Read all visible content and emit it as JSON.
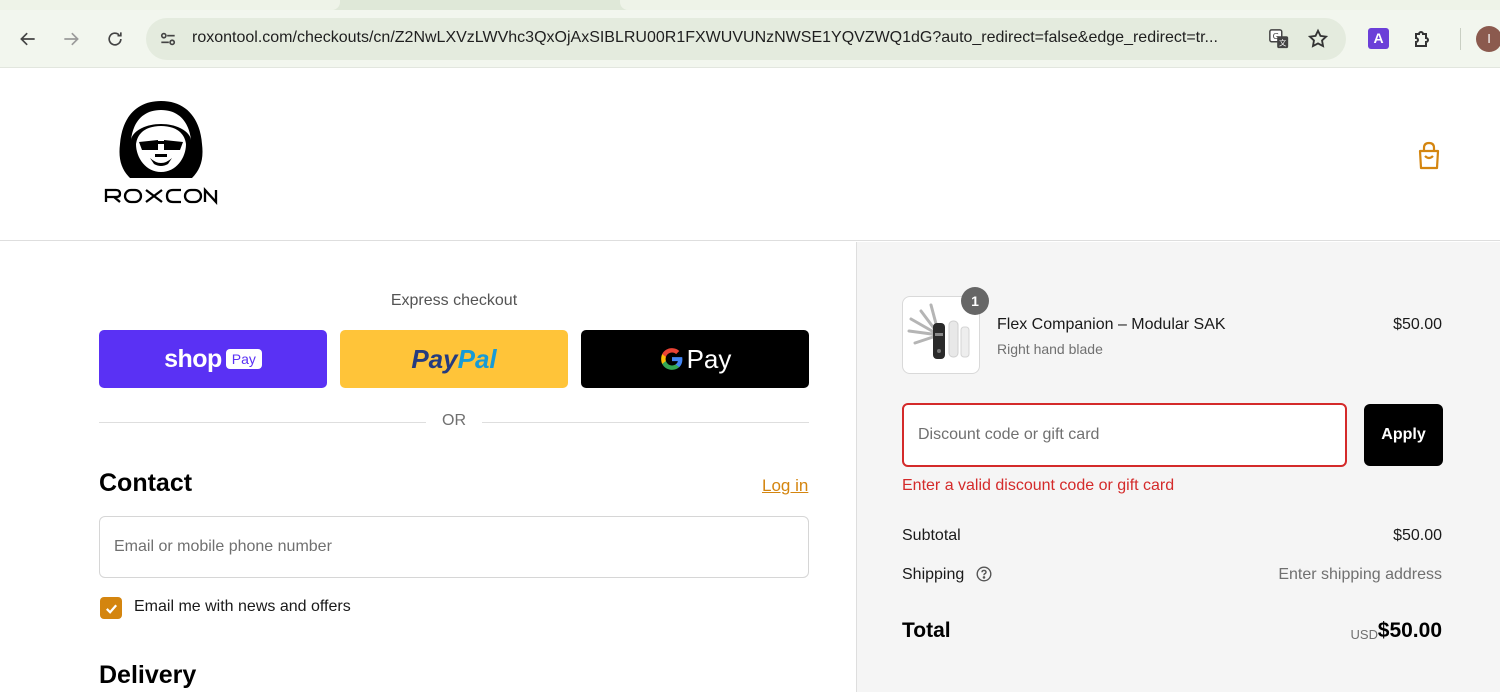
{
  "browser": {
    "url": "roxontool.com/checkouts/cn/Z2NwLXVzLWVhc3QxOjAxSIBLRU00R1FXWUVUNzNWSE1YQVZWQ1dG?auto_redirect=false&edge_redirect=tr...",
    "extension_label": "A",
    "profile_initial": "I"
  },
  "header": {
    "logo_text": "ROXCON"
  },
  "express": {
    "label": "Express checkout",
    "shop_text": "shop",
    "shop_pay_badge": "Pay",
    "paypal_pay": "Pay",
    "paypal_pal": "Pal",
    "gpay_text": "Pay",
    "or_label": "OR"
  },
  "contact": {
    "title": "Contact",
    "login_label": "Log in",
    "email_placeholder": "Email or mobile phone number",
    "newsletter_label": "Email me with news and offers",
    "newsletter_checked": true
  },
  "delivery": {
    "title": "Delivery"
  },
  "summary": {
    "product": {
      "name": "Flex Companion – Modular SAK",
      "variant": "Right hand blade",
      "price": "$50.00",
      "quantity": "1"
    },
    "discount_placeholder": "Discount code or gift card",
    "apply_label": "Apply",
    "discount_error": "Enter a valid discount code or gift card",
    "subtotal_label": "Subtotal",
    "subtotal_value": "$50.00",
    "shipping_label": "Shipping",
    "shipping_value": "Enter shipping address",
    "total_label": "Total",
    "currency": "USD",
    "total_value": "$50.00"
  },
  "colors": {
    "accent": "#d4850f",
    "error": "#d42a2a",
    "shop_pay": "#5a31f4",
    "paypal": "#ffc439"
  }
}
